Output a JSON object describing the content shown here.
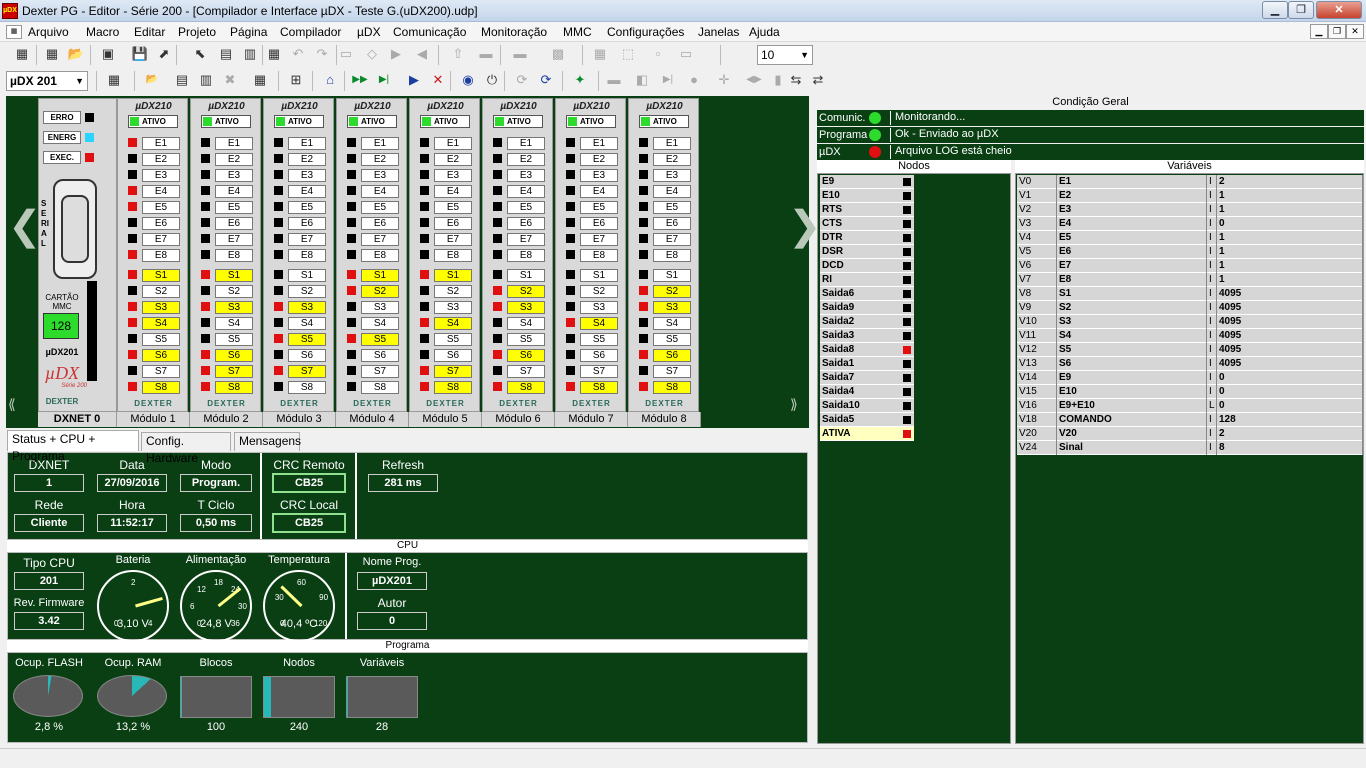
{
  "window": {
    "title": "Dexter PG - Editor - Série 200 - [Compilador e Interface µDX - Teste G.(uDX200).udp]",
    "icon": "µDX"
  },
  "menu": [
    "Arquivo",
    "Macro",
    "Editar",
    "Projeto",
    "Página",
    "Compilador",
    "µDX",
    "Comunicação",
    "Monitoração",
    "MMC",
    "Configurações",
    "Janelas",
    "Ajuda"
  ],
  "toolbar": {
    "zoom": "10",
    "device": "µDX 201"
  },
  "rack": {
    "cpu": {
      "leds": [
        "ERRO",
        "ENERG",
        "EXEC."
      ],
      "serial": "SERIAL",
      "mmc_label": "CARTÃO MMC",
      "card": "128",
      "model": "µDX201",
      "brand": "µDX",
      "brand_sub": "Série 200",
      "maker": "DEXTER",
      "label": "DXNET 0"
    },
    "module_header": "µDX210",
    "ativo": "ATIVO",
    "maker": "DEXTER",
    "modules": [
      {
        "label": "Módulo 1",
        "e": [
          1,
          0,
          0,
          1,
          1,
          0,
          0,
          1
        ],
        "s": [
          1,
          0,
          1,
          1,
          0,
          1,
          0,
          1
        ]
      },
      {
        "label": "Módulo 2",
        "e": [
          0,
          0,
          0,
          0,
          0,
          0,
          0,
          0
        ],
        "s": [
          1,
          0,
          1,
          0,
          0,
          1,
          1,
          1
        ]
      },
      {
        "label": "Módulo 3",
        "e": [
          0,
          0,
          0,
          0,
          0,
          0,
          0,
          0
        ],
        "s": [
          0,
          0,
          1,
          0,
          1,
          0,
          1,
          0
        ]
      },
      {
        "label": "Módulo 4",
        "e": [
          0,
          0,
          0,
          0,
          0,
          0,
          0,
          0
        ],
        "s": [
          1,
          1,
          0,
          0,
          1,
          0,
          0,
          0
        ]
      },
      {
        "label": "Módulo 5",
        "e": [
          0,
          0,
          0,
          0,
          0,
          0,
          0,
          0
        ],
        "s": [
          1,
          0,
          0,
          1,
          0,
          0,
          1,
          1
        ]
      },
      {
        "label": "Módulo 6",
        "e": [
          0,
          0,
          0,
          0,
          0,
          0,
          0,
          0
        ],
        "s": [
          0,
          1,
          1,
          0,
          0,
          1,
          0,
          1
        ]
      },
      {
        "label": "Módulo 7",
        "e": [
          0,
          0,
          0,
          0,
          0,
          0,
          0,
          0
        ],
        "s": [
          0,
          0,
          0,
          1,
          0,
          0,
          0,
          1
        ]
      },
      {
        "label": "Módulo 8",
        "e": [
          0,
          0,
          0,
          0,
          0,
          0,
          0,
          0
        ],
        "s": [
          0,
          1,
          1,
          0,
          0,
          1,
          0,
          1
        ]
      }
    ]
  },
  "tabs": [
    "Status + CPU + Programa",
    "Config. Hardware",
    "Mensagens"
  ],
  "status": {
    "dxnet_l": "DXNET",
    "dxnet": "1",
    "data_l": "Data",
    "data": "27/09/2016",
    "modo_l": "Modo",
    "modo": "Program.",
    "rede_l": "Rede",
    "rede": "Cliente",
    "hora_l": "Hora",
    "hora": "11:52:17",
    "tciclo_l": "T Ciclo",
    "tciclo": "0,50 ms",
    "crcr_l": "CRC Remoto",
    "crcr": "CB25",
    "crcl_l": "CRC Local",
    "crcl": "CB25",
    "refresh_l": "Refresh",
    "refresh": "281 ms"
  },
  "cpu": {
    "hdr": "CPU",
    "tipo_l": "Tipo CPU",
    "tipo": "201",
    "rev_l": "Rev. Firmware",
    "rev": "3.42",
    "gauges": [
      {
        "label": "Bateria",
        "value": "3,10 V",
        "level": 0.775,
        "ticks": [
          "0",
          "2",
          "4"
        ]
      },
      {
        "label": "Alimentação",
        "value": "24,8 V",
        "level": 0.69,
        "ticks": [
          "0",
          "6",
          "12",
          "18",
          "24",
          "30",
          "36"
        ]
      },
      {
        "label": "Temperatura",
        "value": "40,4 ºC",
        "level": 0.33,
        "ticks": [
          "0",
          "30",
          "60",
          "90",
          "120"
        ]
      }
    ],
    "nome_l": "Nome Prog.",
    "nome": "µDX201",
    "autor_l": "Autor",
    "autor": "0"
  },
  "programa": {
    "hdr": "Programa",
    "items": [
      {
        "label": "Ocup. FLASH",
        "value": "2,8 %",
        "kind": "pie",
        "pct": 2.8
      },
      {
        "label": "Ocup. RAM",
        "value": "13,2 %",
        "kind": "pie",
        "pct": 13.2
      },
      {
        "label": "Blocos",
        "value": "100",
        "kind": "bar",
        "pct": 2
      },
      {
        "label": "Nodos",
        "value": "240",
        "kind": "bar",
        "pct": 10
      },
      {
        "label": "Variáveis",
        "value": "28",
        "kind": "bar",
        "pct": 2
      }
    ]
  },
  "cond": {
    "hdr": "Condição Geral",
    "rows": [
      {
        "k": "Comunic.",
        "color": "#2ddb2d",
        "t": "Monitorando..."
      },
      {
        "k": "Programa",
        "color": "#2ddb2d",
        "t": "Ok - Enviado ao µDX"
      },
      {
        "k": "µDX",
        "color": "#e01010",
        "t": "Arquivo LOG está cheio"
      }
    ]
  },
  "nodos": {
    "hdr": "Nodos",
    "rows": [
      [
        "E9",
        0
      ],
      [
        "E10",
        0
      ],
      [
        "RTS",
        0
      ],
      [
        "CTS",
        0
      ],
      [
        "DTR",
        0
      ],
      [
        "DSR",
        0
      ],
      [
        "DCD",
        0
      ],
      [
        "RI",
        0
      ],
      [
        "Saida6",
        0
      ],
      [
        "Saida9",
        0
      ],
      [
        "Saida2",
        0
      ],
      [
        "Saida3",
        0
      ],
      [
        "Saida8",
        1
      ],
      [
        "Saida1",
        0
      ],
      [
        "Saida7",
        0
      ],
      [
        "Saida4",
        0
      ],
      [
        "Saida10",
        0
      ],
      [
        "Saida5",
        0
      ],
      [
        "ATIVA",
        1
      ]
    ]
  },
  "vars": {
    "hdr": "Variáveis",
    "rows": [
      [
        "V0",
        "E1",
        "I",
        "2"
      ],
      [
        "V1",
        "E2",
        "I",
        "1"
      ],
      [
        "V2",
        "E3",
        "I",
        "1"
      ],
      [
        "V3",
        "E4",
        "I",
        "0"
      ],
      [
        "V4",
        "E5",
        "I",
        "1"
      ],
      [
        "V5",
        "E6",
        "I",
        "1"
      ],
      [
        "V6",
        "E7",
        "I",
        "1"
      ],
      [
        "V7",
        "E8",
        "I",
        "1"
      ],
      [
        "V8",
        "S1",
        "I",
        "4095"
      ],
      [
        "V9",
        "S2",
        "I",
        "4095"
      ],
      [
        "V10",
        "S3",
        "I",
        "4095"
      ],
      [
        "V11",
        "S4",
        "I",
        "4095"
      ],
      [
        "V12",
        "S5",
        "I",
        "4095"
      ],
      [
        "V13",
        "S6",
        "I",
        "4095"
      ],
      [
        "V14",
        "E9",
        "I",
        "0"
      ],
      [
        "V15",
        "E10",
        "I",
        "0"
      ],
      [
        "V16",
        "E9+E10",
        "L",
        "0"
      ],
      [
        "V18",
        "COMANDO",
        "I",
        "128"
      ],
      [
        "V20",
        "V20",
        "I",
        "2"
      ],
      [
        "V24",
        "Sinal",
        "I",
        "8"
      ]
    ]
  }
}
